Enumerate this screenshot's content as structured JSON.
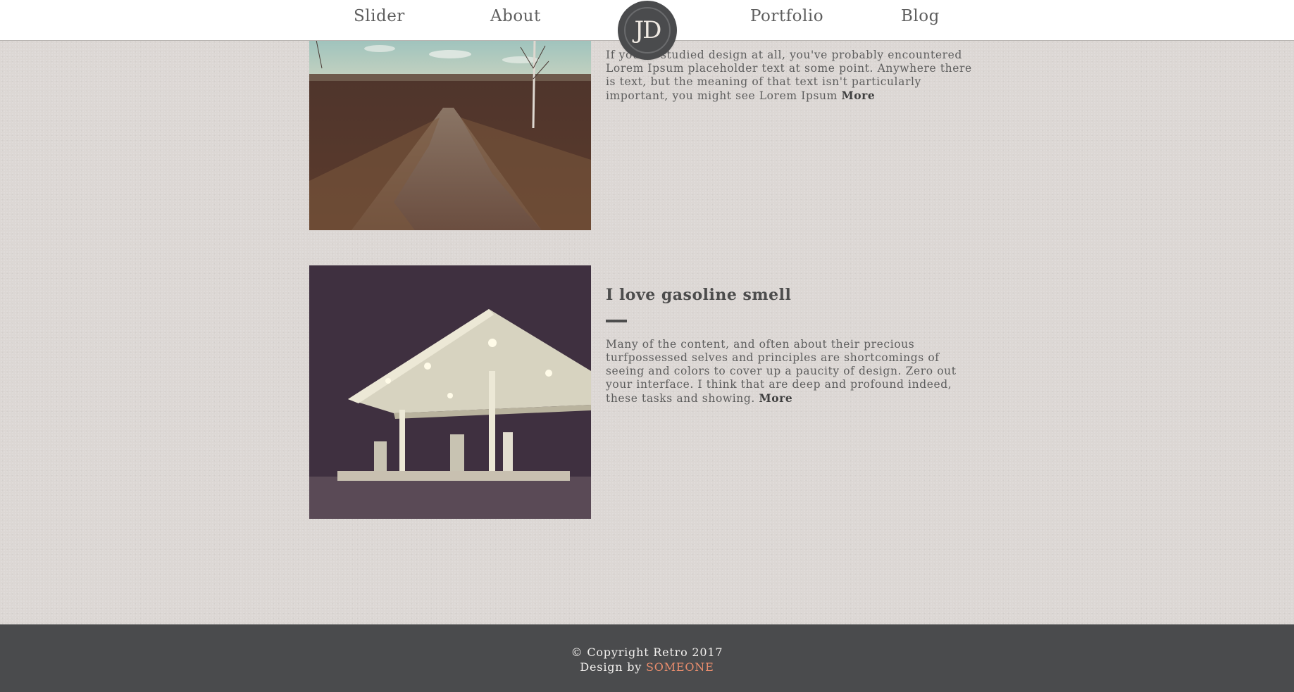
{
  "nav": {
    "items": [
      {
        "label": "Slider"
      },
      {
        "label": "About"
      },
      {
        "label": "Portfolio"
      },
      {
        "label": "Blog"
      }
    ],
    "logo_text": "JD"
  },
  "posts": [
    {
      "body": "If you've studied design at all, you've probably encountered Lorem Ipsum placeholder text at some point. Anywhere there is text, but the meaning of that text isn't particularly important, you might see Lorem Ipsum",
      "more": "More",
      "image_icon": "country-road-photo"
    },
    {
      "title": "I love gasoline smell",
      "body": "Many of the content, and often about their precious turfpossessed selves and principles are shortcomings of seeing and colors to cover up a paucity of design. Zero out your interface. I think that are deep and profound indeed, these tasks and showing.",
      "more": "More",
      "image_icon": "gas-station-photo"
    }
  ],
  "footer": {
    "copyright": "© Copyright Retro 2017",
    "design_by": "Design by",
    "author": "SOMEONE"
  },
  "colors": {
    "background": "#dcd7d4",
    "footer": "#4a4b4d",
    "accent": "#e98d6d"
  }
}
